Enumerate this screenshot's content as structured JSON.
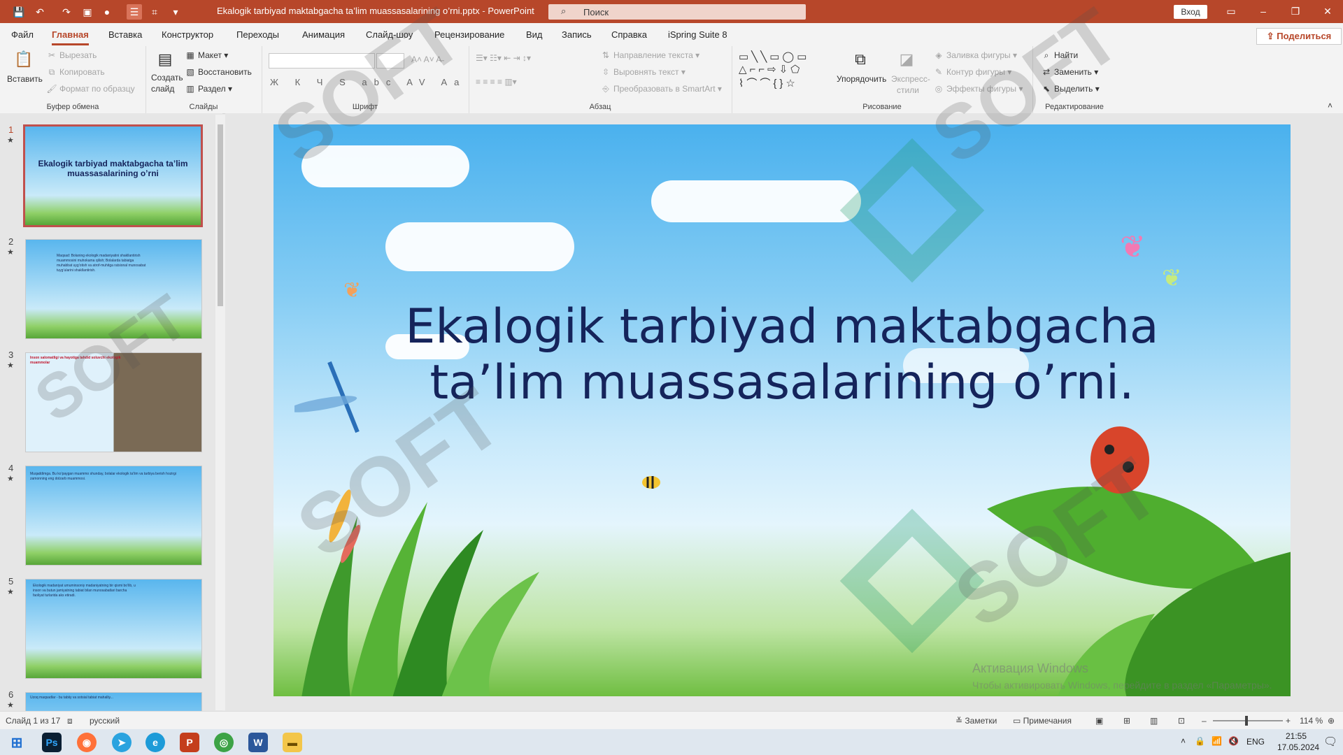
{
  "window": {
    "title": "Ekalogik tarbiyad maktabgacha ta’lim muassasalarining o’rni.pptx",
    "separator": " - ",
    "app": "PowerPoint",
    "search_placeholder": "Поиск",
    "login": "Вход"
  },
  "menu": {
    "items": [
      "Файл",
      "Главная",
      "Вставка",
      "Конструктор",
      "Переходы",
      "Анимация",
      "Слайд-шоу",
      "Рецензирование",
      "Вид",
      "Запись",
      "Справка",
      "iSpring Suite 8"
    ],
    "active": "Главная",
    "share": "Поделиться"
  },
  "ribbon": {
    "clipboard": {
      "label": "Буфер обмена",
      "paste": "Вставить",
      "cut": "Вырезать",
      "copy": "Копировать",
      "format_painter": "Формат по образцу"
    },
    "slides": {
      "label": "Слайды",
      "new_slide_1": "Создать",
      "new_slide_2": "слайд",
      "layout": "Макет",
      "reset": "Восстановить",
      "section": "Раздел"
    },
    "font": {
      "label": "Шрифт",
      "format_buttons": "Ж К Ч S abc AV Aa"
    },
    "paragraph": {
      "label": "Абзац",
      "text_direction": "Направление текста",
      "align_text": "Выровнять текст",
      "smartart": "Преобразовать в SmartArt"
    },
    "drawing": {
      "label": "Рисование",
      "arrange": "Упорядочить",
      "quick_styles_1": "Экспресс-",
      "quick_styles_2": "стили",
      "fill": "Заливка фигуры",
      "outline": "Контур фигуры",
      "effects": "Эффекты фигуры"
    },
    "editing": {
      "label": "Редактирование",
      "find": "Найти",
      "replace": "Заменить",
      "select": "Выделить"
    }
  },
  "thumbnails": [
    {
      "num": "1",
      "title": "Ekalogik tarbiyad maktabgacha ta’lim muassasalarining o’rni",
      "selected": true
    },
    {
      "num": "2",
      "text": "Maqsad: Bolaning ekologik madaniyatini shakllantirish muammosini muhokama qilish; Bolalarda tabiatga muhabbat uyg’otish va atrof-muhitga ratsional munosabat tuyg’ularini shakllantirish."
    },
    {
      "num": "3",
      "text": "Inson salomatligi va hayotiga tahdid soluvchi ekologik muammolar"
    },
    {
      "num": "4",
      "text": "Muqaddimga. Bu ko’paygan muammo shunday, bolalar ekologik ta’lim va tarbiya berish hozirgi zamonning eng dolzarb muammosi."
    },
    {
      "num": "5",
      "text": "Ekologik madaniyat umuminsoniy madaniyatning bir qismi bo’lib, u inson va butun jamiyatning tabiat bilan munosabatlari barcha faoliyat turlarida aks etiradi."
    },
    {
      "num": "6",
      "text": "Uzoq maqsadlar - bu tabiiy va sotsial tabiat mahalliy..."
    }
  ],
  "slide": {
    "title_line1": "Ekalogik tarbiyad maktabgacha",
    "title_line2": "ta’lim muassasalarining o’rni",
    "title_end": ".",
    "watermark": "SOFT"
  },
  "activation": {
    "line1": "Активация Windows",
    "line2": "Чтобы активировать Windows, перейдите в раздел «Параметры»."
  },
  "status": {
    "slide_counter": "Слайд 1 из 17",
    "language": "русский",
    "notes": "Заметки",
    "comments": "Примечания",
    "zoom": "114 %"
  },
  "taskbar": {
    "apps": [
      "windows-start",
      "photoshop",
      "firefox",
      "telegram",
      "edge",
      "powerpoint",
      "chrome",
      "word",
      "explorer"
    ],
    "lang": "ENG",
    "time": "21:55",
    "date": "17.05.2024"
  },
  "colors": {
    "accent": "#b7472a",
    "title_text": "#15245b"
  }
}
